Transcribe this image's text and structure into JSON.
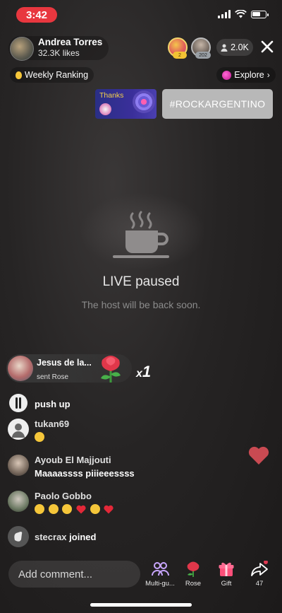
{
  "status_bar": {
    "time": "3:42"
  },
  "host": {
    "name": "Andrea Torres",
    "likes": "32.3K likes"
  },
  "viewers": {
    "badge_1": "2",
    "badge_2": "202",
    "count": "2.0K"
  },
  "nav": {
    "weekly_ranking": "Weekly Ranking",
    "explore": "Explore"
  },
  "banner": {
    "thanks": "Thanks",
    "hashtag": "#ROCKARGENTINO"
  },
  "paused": {
    "title": "LIVE paused",
    "subtitle": "The host will be back soon."
  },
  "gift": {
    "sender": "Jesus de la...",
    "action": "sent Rose",
    "multiplier_x": "x",
    "multiplier_n": "1"
  },
  "comments": [
    {
      "name": "",
      "text": "push up"
    },
    {
      "name": "tukan69",
      "text": ""
    },
    {
      "name": "Ayoub El Majjouti",
      "text": "Maaaassss piiieeessss"
    },
    {
      "name": "Paolo Gobbo",
      "text": ""
    },
    {
      "name": "stecrax",
      "text": "joined"
    }
  ],
  "bottom_bar": {
    "comment_placeholder": "Add comment...",
    "multi_guest": "Multi-gu...",
    "rose": "Rose",
    "gift": "Gift",
    "share_count": "47"
  },
  "colors": {
    "time_pill": "#e8373f",
    "heart": "#c94a52",
    "rose": "#e0374a"
  }
}
